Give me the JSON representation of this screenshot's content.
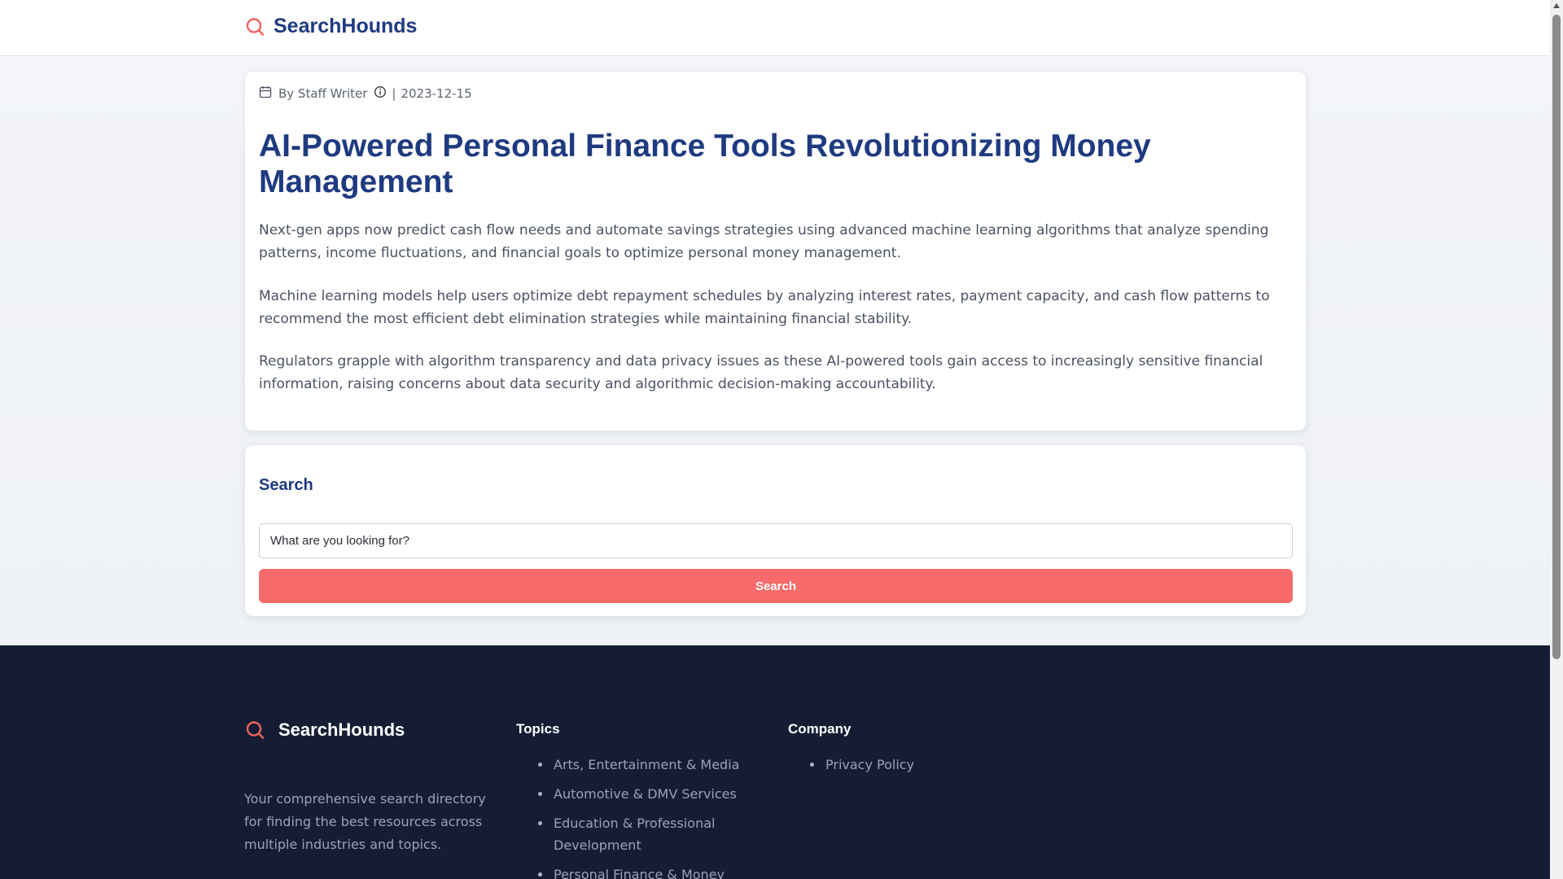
{
  "header": {
    "brand_name": "SearchHounds",
    "brand_icon": "search-icon"
  },
  "article": {
    "meta": {
      "calendar_icon": "calendar-icon",
      "author": "By Staff Writer",
      "info_icon": "info-icon",
      "separator": "|",
      "date": "2023-12-15"
    },
    "title": "AI-Powered Personal Finance Tools Revolutionizing Money Management",
    "paragraphs": [
      "Next-gen apps now predict cash flow needs and automate savings strategies using advanced machine learning algorithms that analyze spending patterns, income fluctuations, and financial goals to optimize personal money management.",
      "Machine learning models help users optimize debt repayment schedules by analyzing interest rates, payment capacity, and cash flow patterns to recommend the most efficient debt elimination strategies while maintaining financial stability.",
      "Regulators grapple with algorithm transparency and data privacy issues as these AI-powered tools gain access to increasingly sensitive financial information, raising concerns about data security and algorithmic decision-making accountability."
    ]
  },
  "search": {
    "heading": "Search",
    "input_value": "",
    "placeholder": "What are you looking for?",
    "button_label": "Search"
  },
  "footer": {
    "brand_name": "SearchHounds",
    "description": "Your comprehensive search directory for finding the best resources across multiple industries and topics.",
    "topics": {
      "title": "Topics",
      "items": [
        "Arts, Entertainment & Media",
        "Automotive & DMV Services",
        "Education & Professional Development",
        "Personal Finance & Money"
      ]
    },
    "company": {
      "title": "Company",
      "items": [
        "Privacy Policy"
      ]
    }
  },
  "colors": {
    "brand_navy": "#1e3a80",
    "accent_coral": "#f96a6a",
    "footer_bg": "#141d34"
  }
}
